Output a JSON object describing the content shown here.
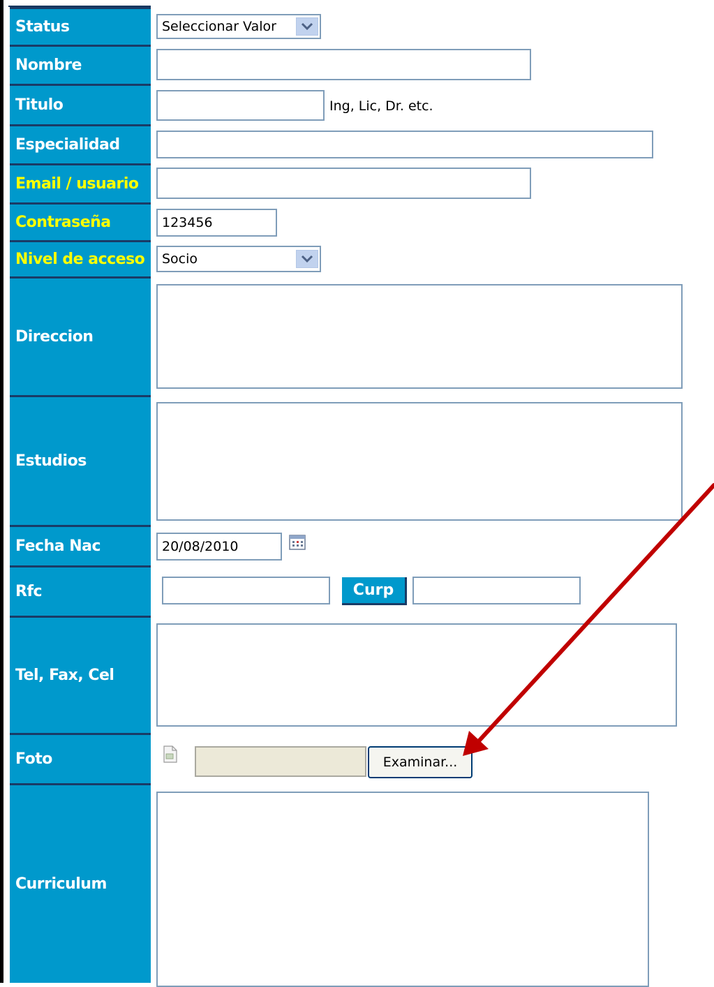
{
  "form": {
    "status": {
      "label": "Status",
      "value": "Seleccionar Valor"
    },
    "nombre": {
      "label": "Nombre",
      "value": ""
    },
    "titulo": {
      "label": "Titulo",
      "value": "",
      "hint": "Ing, Lic, Dr. etc."
    },
    "especialidad": {
      "label": "Especialidad",
      "value": ""
    },
    "email": {
      "label": "Email / usuario",
      "value": ""
    },
    "contrasena": {
      "label": "Contraseña",
      "value": "123456"
    },
    "nivel": {
      "label": "Nivel de acceso",
      "value": "Socio"
    },
    "direccion": {
      "label": "Direccion",
      "value": ""
    },
    "estudios": {
      "label": "Estudios",
      "value": ""
    },
    "fecha_nac": {
      "label": "Fecha Nac",
      "value": "20/08/2010"
    },
    "rfc": {
      "label": "Rfc",
      "value": ""
    },
    "curp": {
      "label": "Curp",
      "value": ""
    },
    "tel": {
      "label": "Tel, Fax, Cel",
      "value": ""
    },
    "foto": {
      "label": "Foto",
      "browse_label": "Examinar..."
    },
    "curriculum": {
      "label": "Curriculum",
      "value": ""
    }
  },
  "colors": {
    "label_bg": "#0099cc",
    "label_text": "#ffffff",
    "required_label_text": "#ffff00",
    "annotation_arrow": "#c00000"
  },
  "icons": {
    "select_arrow": "chevron-down-icon",
    "calendar": "calendar-icon",
    "photo_placeholder": "broken-image-icon",
    "annotation": "red-arrow-icon"
  }
}
